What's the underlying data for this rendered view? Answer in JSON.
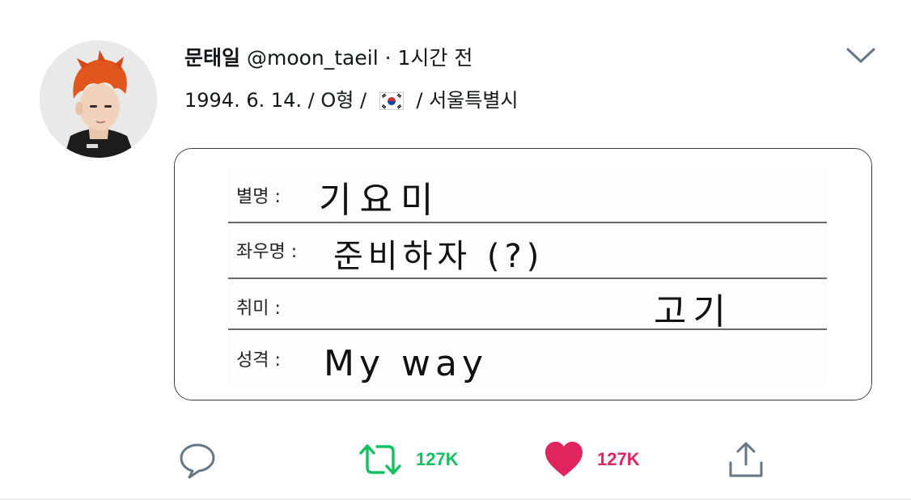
{
  "tweet": {
    "display_name": "문태일",
    "handle": "@moon_taeil",
    "separator": "·",
    "time": "1시간 전",
    "meta_birth": "1994. 6. 14. /",
    "meta_blood": "O형 /",
    "flag_icon": "korea-flag-icon",
    "meta_city": "/ 서울특별시"
  },
  "card": {
    "rows": [
      {
        "label": "별명 :",
        "value": "기요미"
      },
      {
        "label": "좌우명 :",
        "value": "준비하자 (?)"
      },
      {
        "label": "취미 :",
        "value": "고기"
      },
      {
        "label": "성격 :",
        "value": "My way"
      }
    ]
  },
  "actions": {
    "reply_icon": "reply-icon",
    "retweet_count": "127K",
    "like_count": "127K",
    "share_icon": "share-icon"
  },
  "colors": {
    "retweet": "#17bf63",
    "like": "#e0245e",
    "icon_gray": "#657786",
    "hair": "#e0561c"
  }
}
